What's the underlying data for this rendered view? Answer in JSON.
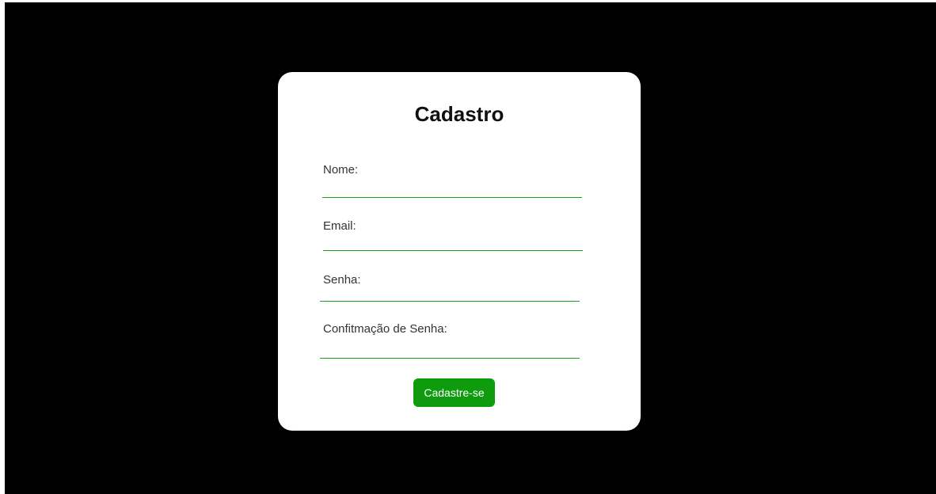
{
  "form": {
    "title": "Cadastro",
    "fields": [
      {
        "label": "Nome:",
        "value": ""
      },
      {
        "label": "Email:",
        "value": ""
      },
      {
        "label": "Senha:",
        "value": ""
      },
      {
        "label": "Confitmação de Senha:",
        "value": ""
      }
    ],
    "submit_label": "Cadastre-se"
  },
  "colors": {
    "background": "#000000",
    "card": "#ffffff",
    "accent": "#0e9b0e",
    "underline": "#1aa31a"
  }
}
